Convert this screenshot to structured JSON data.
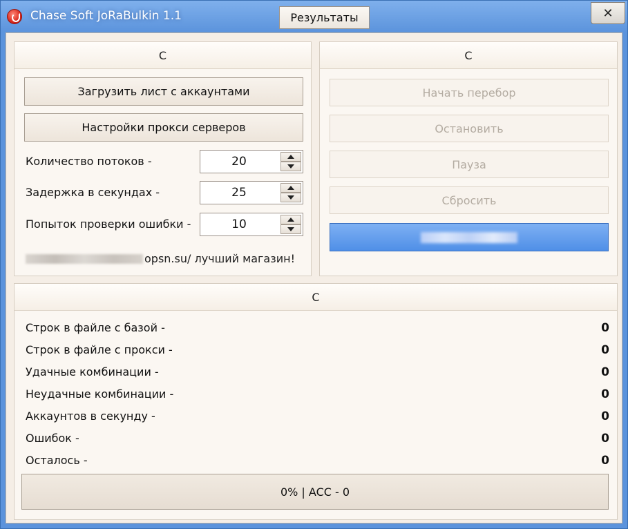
{
  "window": {
    "title": "Chase Soft JoRaBulkin 1.1",
    "results_button": "Результаты",
    "close_glyph": "✕"
  },
  "left_panel": {
    "header": "C",
    "load_accounts_button": "Загрузить лист с аккаунтами",
    "proxy_settings_button": "Настройки прокси серверов",
    "threads_label": "Количество потоков -",
    "threads_value": "20",
    "delay_label": "Задержка в секундах -",
    "delay_value": "25",
    "retries_label": "Попыток проверки ошибки -",
    "retries_value": "10",
    "promo_text": "opsn.su/ лучший магазин!"
  },
  "right_panel": {
    "header": "C",
    "start_button": "Начать перебор",
    "stop_button": "Остановить",
    "pause_button": "Пауза",
    "reset_button": "Сбросить"
  },
  "stats_panel": {
    "header": "C",
    "rows": [
      {
        "label": "Строк в файле с базой -",
        "value": "0"
      },
      {
        "label": "Строк в файле с прокси -",
        "value": "0"
      },
      {
        "label": "Удачные комбинации -",
        "value": "0"
      },
      {
        "label": "Неудачные комбинации -",
        "value": "0"
      },
      {
        "label": "Аккаунтов в секунду -",
        "value": "0"
      },
      {
        "label": "Ошибок -",
        "value": "0"
      },
      {
        "label": "Осталось -",
        "value": "0"
      }
    ],
    "status": "0% | ACC - 0"
  },
  "colors": {
    "title_bar": "#5b93dc",
    "client_bg": "#f5eee6",
    "primary_button": "#4f8fe7",
    "disabled_text": "#b4aca2"
  }
}
